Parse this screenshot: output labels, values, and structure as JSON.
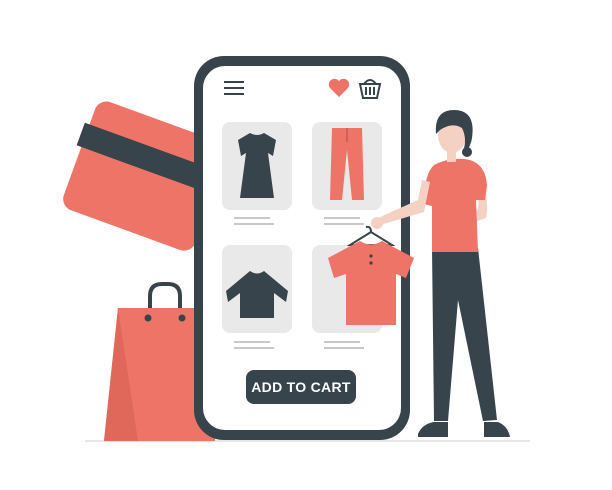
{
  "illustration": {
    "subject": "online-shopping",
    "colors": {
      "accent": "#EE7467",
      "dark": "#38444B",
      "screen": "#FFFFFF",
      "tile": "#E9E9E9",
      "skin": "#F5D1C3",
      "ground": "#E6E6E6"
    }
  },
  "app": {
    "menu_icon": "hamburger-icon",
    "favorite_icon": "heart-icon",
    "cart_icon": "basket-icon",
    "products": [
      {
        "name": "dress",
        "icon": "dress-icon"
      },
      {
        "name": "trousers",
        "icon": "trousers-icon"
      },
      {
        "name": "sweater",
        "icon": "sweater-icon"
      },
      {
        "name": "t-shirt",
        "icon": "tshirt-icon"
      }
    ],
    "add_to_cart_label": "ADD TO CART"
  }
}
